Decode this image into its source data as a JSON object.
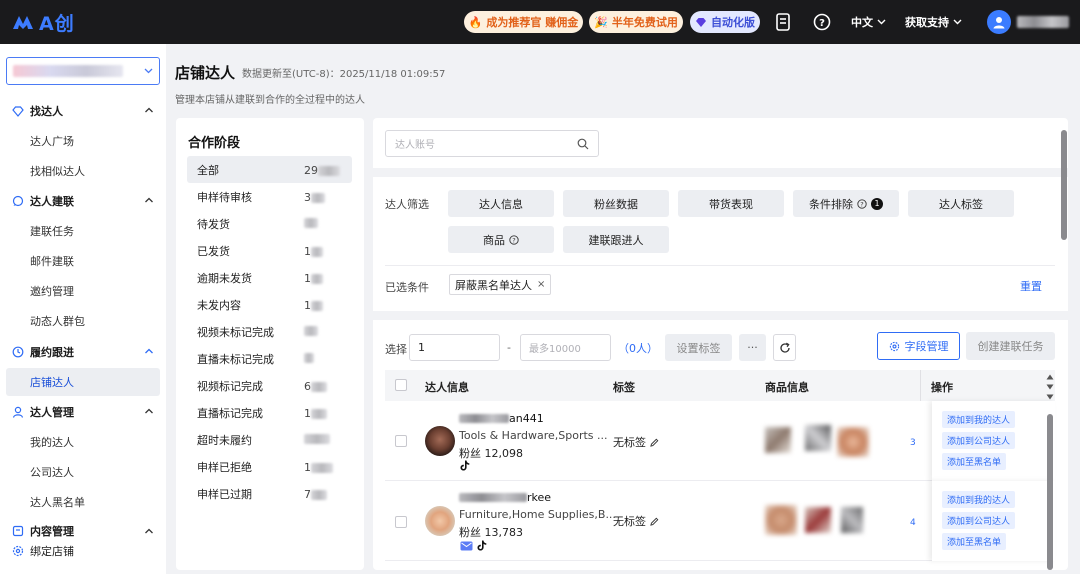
{
  "app": {
    "brand": "A创"
  },
  "topbar": {
    "promo1": "成为推荐官 赚佣金",
    "promo2": "半年免费试用",
    "promo3": "自动化版",
    "language": "中文",
    "support": "获取支持"
  },
  "sidebar": {
    "groups": [
      {
        "label": "找达人",
        "icon": "diamond-icon",
        "items": [
          "达人广场",
          "找相似达人"
        ]
      },
      {
        "label": "达人建联",
        "icon": "chat-icon",
        "items": [
          "建联任务",
          "邮件建联",
          "邀约管理",
          "动态人群包"
        ]
      },
      {
        "label": "履约跟进",
        "icon": "clock-icon",
        "items": [
          "店铺达人"
        ]
      },
      {
        "label": "达人管理",
        "icon": "user-icon",
        "items": [
          "我的达人",
          "公司达人",
          "达人黑名单"
        ]
      },
      {
        "label": "内容管理",
        "icon": "content-icon",
        "items": []
      }
    ],
    "active_item": "店铺达人",
    "footer": "绑定店铺"
  },
  "page": {
    "title": "店铺达人",
    "updated": "数据更新至(UTC-8)：2025/11/18 01:09:57",
    "description": "管理本店铺从建联到合作的全过程中的达人"
  },
  "stages": {
    "title": "合作阶段",
    "items": [
      {
        "label": "全部",
        "count": "29"
      },
      {
        "label": "申样待审核",
        "count": "3"
      },
      {
        "label": "待发货",
        "count": ""
      },
      {
        "label": "已发货",
        "count": "1"
      },
      {
        "label": "逾期未发货",
        "count": "1"
      },
      {
        "label": "未发内容",
        "count": "1"
      },
      {
        "label": "视频未标记完成",
        "count": ""
      },
      {
        "label": "直播未标记完成",
        "count": ""
      },
      {
        "label": "视频标记完成",
        "count": "6"
      },
      {
        "label": "直播标记完成",
        "count": "1"
      },
      {
        "label": "超时未履约",
        "count": ""
      },
      {
        "label": "申样已拒绝",
        "count": "1"
      },
      {
        "label": "申样已过期",
        "count": "7"
      }
    ]
  },
  "search": {
    "placeholder": "达人账号"
  },
  "filters": {
    "label": "达人筛选",
    "buttons": [
      "达人信息",
      "粉丝数据",
      "带货表现",
      "条件排除",
      "达人标签",
      "商品",
      "建联跟进人"
    ],
    "exclusion_badge": "1",
    "selected_label": "已选条件",
    "selected_chip": "屏蔽黑名单达人",
    "reset": "重置"
  },
  "toolbar": {
    "select_label": "选择",
    "from_value": "1",
    "dash": "-",
    "to_placeholder": "最多10000",
    "count": "（0人）",
    "set_tag": "设置标签",
    "more": "···",
    "field_manage": "字段管理",
    "create_task": "创建建联任务"
  },
  "table": {
    "headers": [
      "达人信息",
      "标签",
      "商品信息",
      "操作"
    ],
    "rows": [
      {
        "name_suffix": "an441",
        "category": "Tools & Hardware,Sports ...",
        "fans_label": "粉丝",
        "fans": "12,098",
        "tag": "无标签",
        "more": "3",
        "ops": [
          "添加到我的达人",
          "添加到公司达人",
          "添加至黑名单"
        ]
      },
      {
        "name_suffix": "rkee",
        "category": "Furniture,Home Supplies,B...",
        "fans_label": "粉丝",
        "fans": "13,783",
        "tag": "无标签",
        "more": "4",
        "ops": [
          "添加到我的达人",
          "添加到公司达人",
          "添加至黑名单"
        ]
      }
    ]
  },
  "colors": {
    "accent": "#2f6cf5",
    "topbar": "#1a1a1c",
    "promo": "#e2621b"
  }
}
